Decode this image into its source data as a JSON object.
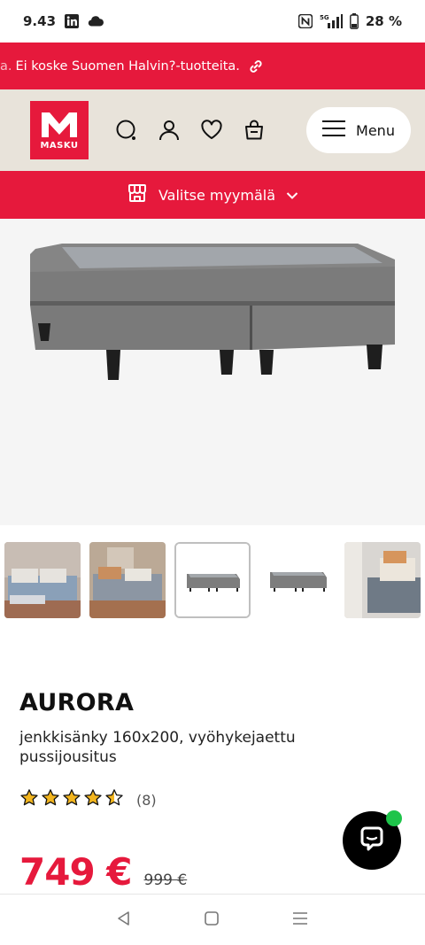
{
  "status_bar": {
    "time": "9.43",
    "battery": "28 %"
  },
  "promo": {
    "fade_text": "a.",
    "text": "Ei koske Suomen Halvin?-tuotteita."
  },
  "header": {
    "logo_text": "MASKU",
    "menu_label": "Menu"
  },
  "store": {
    "label": "Valitse myymälä"
  },
  "product": {
    "name": "AURORA",
    "description": "jenkkisänky 160x200, vyöhykejaettu pussijousitus",
    "rating_count": "(8)",
    "rating_value": 4.5,
    "price": "749 €",
    "old_price": "999 €"
  },
  "colors": {
    "brand_red": "#e6193c",
    "header_beige": "#e8e3da",
    "bed_gray": "#7b7b7b"
  }
}
